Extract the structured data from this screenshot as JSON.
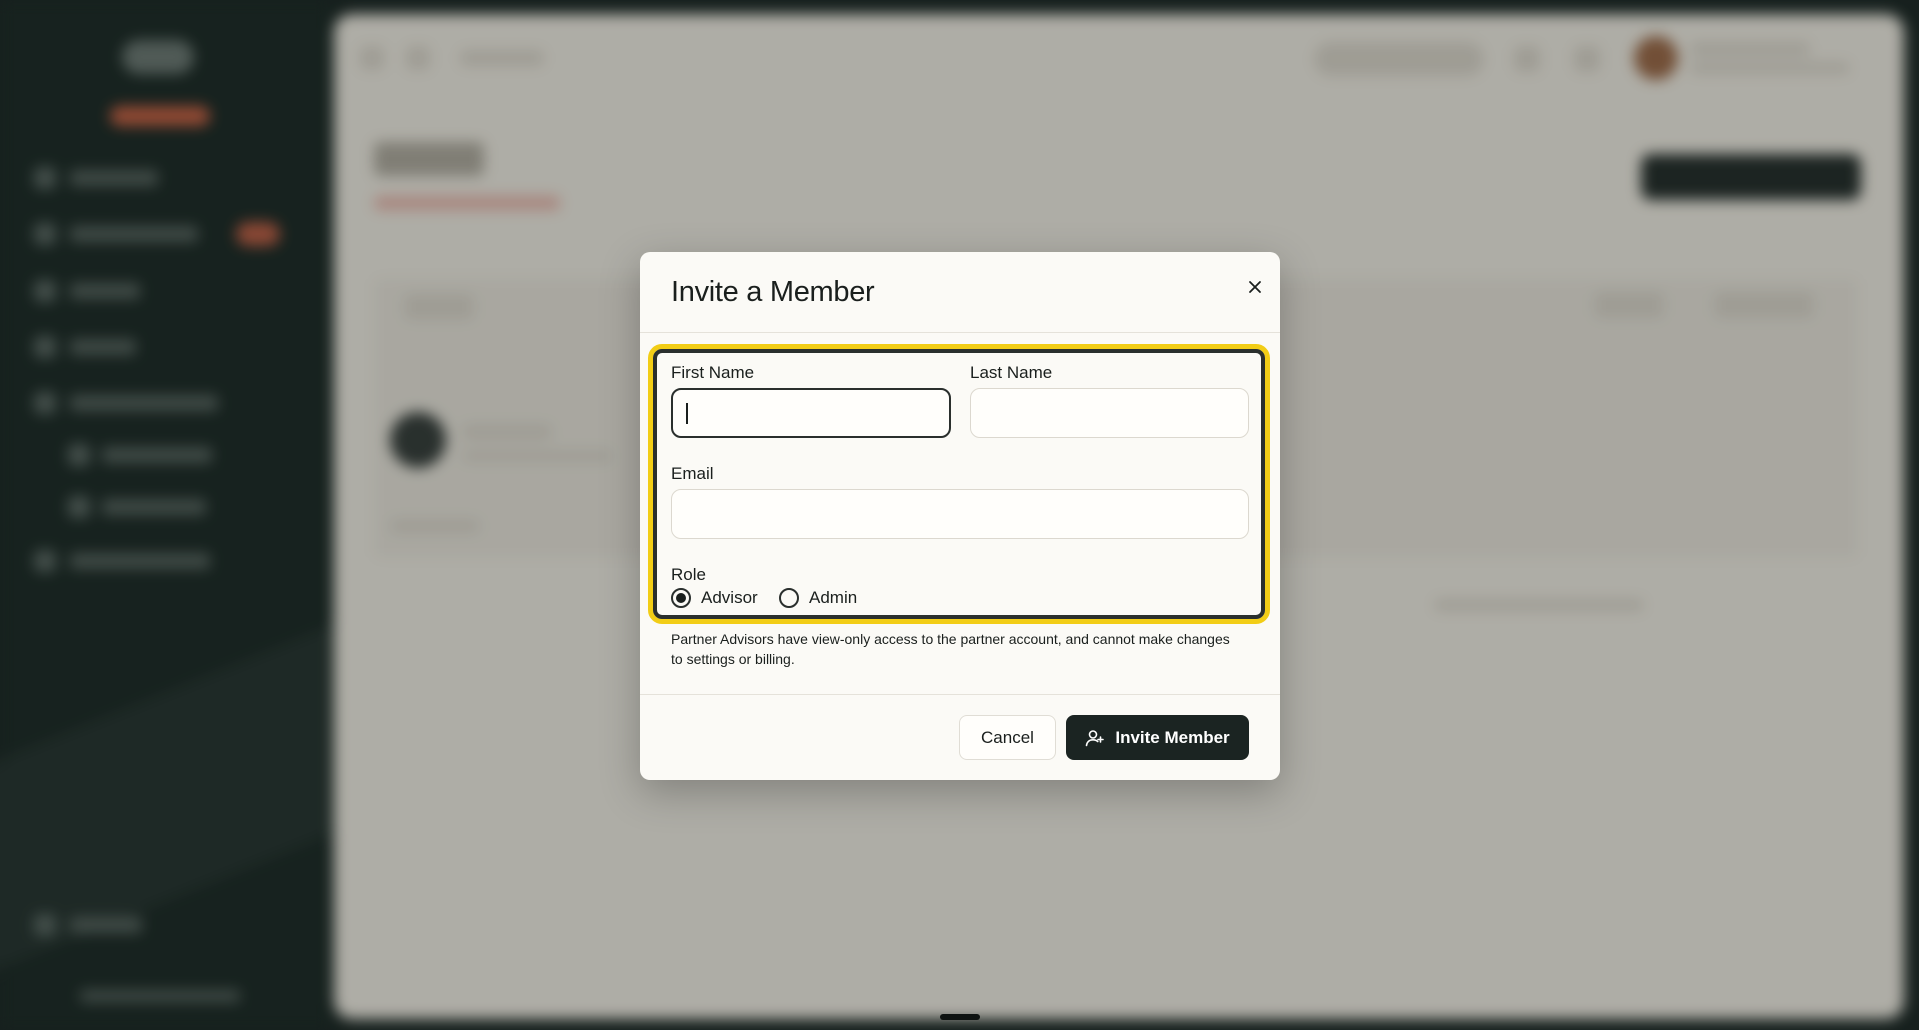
{
  "modal": {
    "title": "Invite a Member",
    "fields": {
      "first_name_label": "First Name",
      "first_name_value": "",
      "last_name_label": "Last Name",
      "last_name_value": "",
      "email_label": "Email",
      "email_value": "",
      "role_label": "Role",
      "role_options": [
        "Advisor",
        "Admin"
      ],
      "role_selected": "Advisor"
    },
    "help_text": "Partner Advisors have view-only access to the partner account, and cannot make changes to settings or billing.",
    "buttons": {
      "cancel": "Cancel",
      "invite": "Invite Member"
    }
  },
  "icons": {
    "close": "close-icon",
    "invite": "user-plus-icon"
  },
  "colors": {
    "highlight": "#f2cd16",
    "primary_button": "#1b2422",
    "modal_background": "#fbfaf6"
  }
}
